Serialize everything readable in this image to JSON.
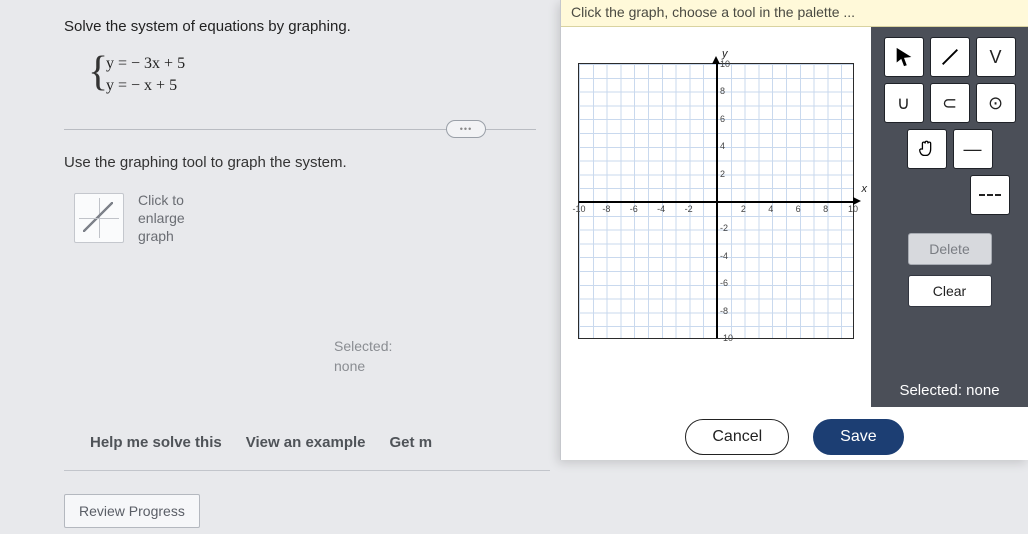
{
  "question": {
    "title": "Solve the system of equations by graphing.",
    "equation_1": "y = − 3x + 5",
    "equation_2": "y = − x + 5",
    "instruction": "Use the graphing tool to graph the system.",
    "thumb_label": "Click to\nenlarge\ngraph",
    "selected_label": "Selected:",
    "selected_value": "none"
  },
  "links": {
    "help": "Help me solve this",
    "example": "View an example",
    "more": "Get m",
    "review": "Review Progress"
  },
  "panel": {
    "banner": "Click the graph, choose a tool in the palette ...",
    "axis_y": "y",
    "axis_x": "x",
    "ticks_pos": [
      "2",
      "4",
      "6",
      "8",
      "10"
    ],
    "ticks_neg": [
      "-2",
      "-4",
      "-6",
      "-8",
      "-10"
    ],
    "delete": "Delete",
    "clear": "Clear",
    "selected": "Selected: none",
    "cancel": "Cancel",
    "save": "Save"
  },
  "tools": {
    "pointer": "pointer",
    "line": "line",
    "v": "V",
    "u": "∪",
    "c": "⊂",
    "circle": "⊙",
    "hand": "✋",
    "minus": "—",
    "dashes": "---"
  }
}
